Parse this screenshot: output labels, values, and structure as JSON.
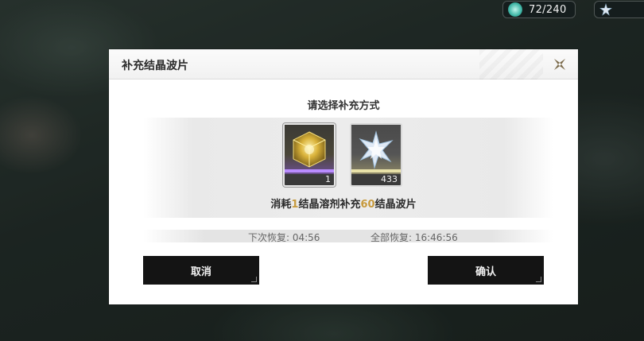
{
  "hud": {
    "crystal": {
      "icon": "crystal-icon",
      "value": "72/240"
    },
    "star": {
      "icon": "star-icon",
      "value": ""
    }
  },
  "dialog": {
    "title": "补充结晶波片",
    "close_icon": "close-icon",
    "prompt": "请选择补充方式",
    "items": [
      {
        "name": "结晶溶剂",
        "icon": "solvent-cube-icon",
        "count": "1",
        "rarity_color": "#b98cff"
      },
      {
        "name": "结晶波片",
        "icon": "wafer-star-icon",
        "count": "433",
        "rarity_color": "#e8e1a8"
      }
    ],
    "consume": {
      "pre": "消耗",
      "amount": "1",
      "mid": "结晶溶剂补充",
      "gain": "60",
      "post": "结晶波片"
    },
    "next_recover": "下次恢复: 04:56",
    "full_recover": "全部恢复: 16:46:56",
    "cancel_label": "取消",
    "confirm_label": "确认"
  },
  "colors": {
    "highlight": "#c79a3e",
    "button_bg": "#141414"
  }
}
